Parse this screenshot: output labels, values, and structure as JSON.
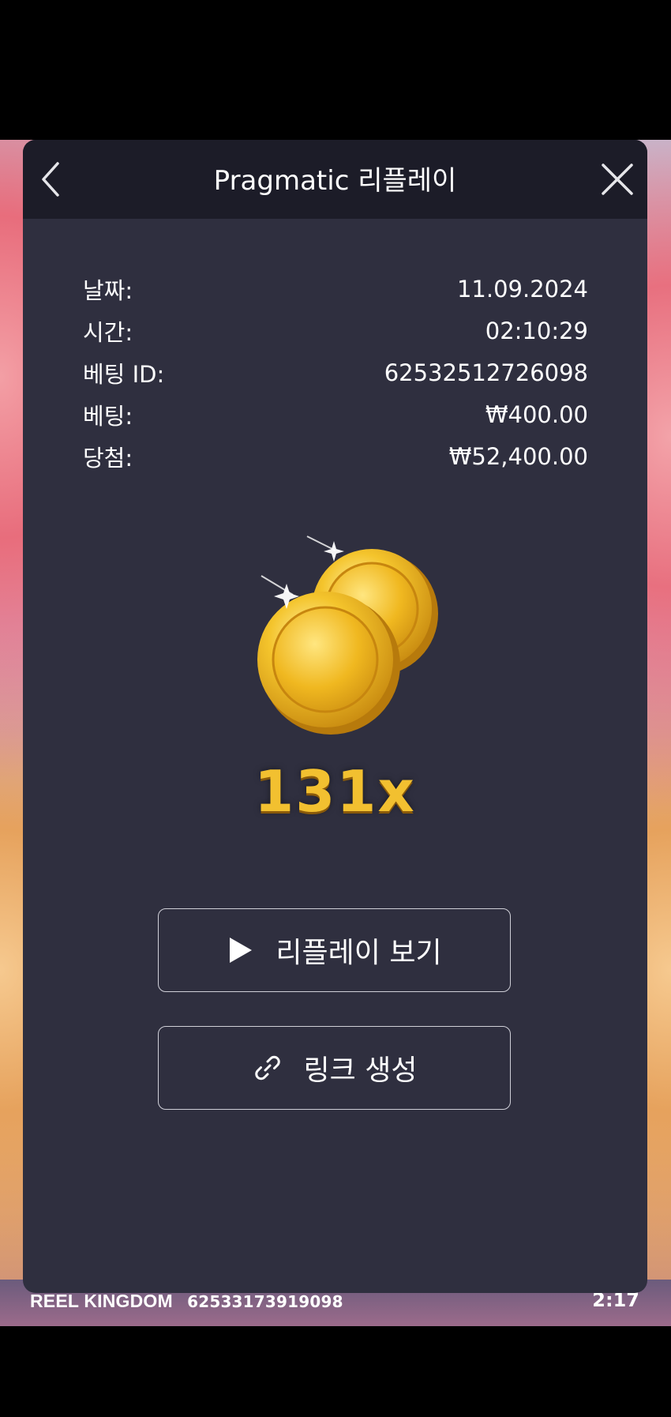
{
  "header": {
    "title": "Pragmatic 리플레이"
  },
  "info": [
    {
      "label": "날짜:",
      "value": "11.09.2024"
    },
    {
      "label": "시간:",
      "value": "02:10:29"
    },
    {
      "label": "베팅 ID:",
      "value": "62532512726098"
    },
    {
      "label": "베팅:",
      "value": "₩400.00"
    },
    {
      "label": "당첨:",
      "value": "₩52,400.00"
    }
  ],
  "win": {
    "multiplier": "131x"
  },
  "buttons": {
    "replay_label": "리플레이 보기",
    "link_label": "링크 생성"
  },
  "footer": {
    "brand": "REEL KINGDOM",
    "round_id": "62533173919098",
    "time": "2:17"
  },
  "colors": {
    "modal_bg": "#2f2f3f",
    "header_bg": "#1c1c28",
    "gold": "#f2c030"
  }
}
